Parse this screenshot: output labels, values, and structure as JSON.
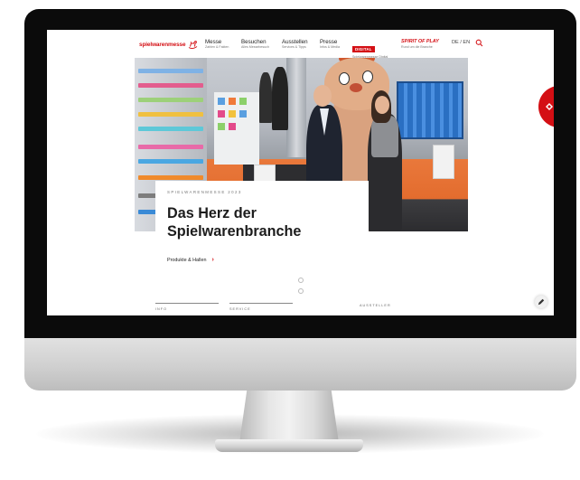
{
  "brand": {
    "logo_text": "spielwarenmesse",
    "accent_color": "#d40f14"
  },
  "nav": {
    "items": [
      {
        "title": "Messe",
        "subtitle": "Zahlen & Fakten"
      },
      {
        "title": "Besuchen",
        "subtitle": "Alles Messebesuch"
      },
      {
        "title": "Ausstellen",
        "subtitle": "Services & Tipps"
      },
      {
        "title": "Presse",
        "subtitle": "Infos & Media"
      }
    ],
    "digital": {
      "badge": "DIGITAL",
      "subtitle": "Spielwarenmesse Digital"
    },
    "spirit": {
      "title": "SPIRIT OF PLAY",
      "subtitle": "Rund um die Branche"
    },
    "language": "DE / EN",
    "search_icon": "search-icon"
  },
  "hero": {
    "eyebrow": "SPIELWARENMESSE 2023",
    "headline": "Das Herz der Spielwarenbranche",
    "link_label": "Produkte & Hallen",
    "link_icon": "chevron-right-icon"
  },
  "tabs": [
    {
      "label": "INFO"
    },
    {
      "label": "SERVICE"
    },
    {
      "label": "AUSSTELLER"
    }
  ],
  "side_badge_icon": "arrow-icon",
  "floating_button_icon": "pencil-icon"
}
